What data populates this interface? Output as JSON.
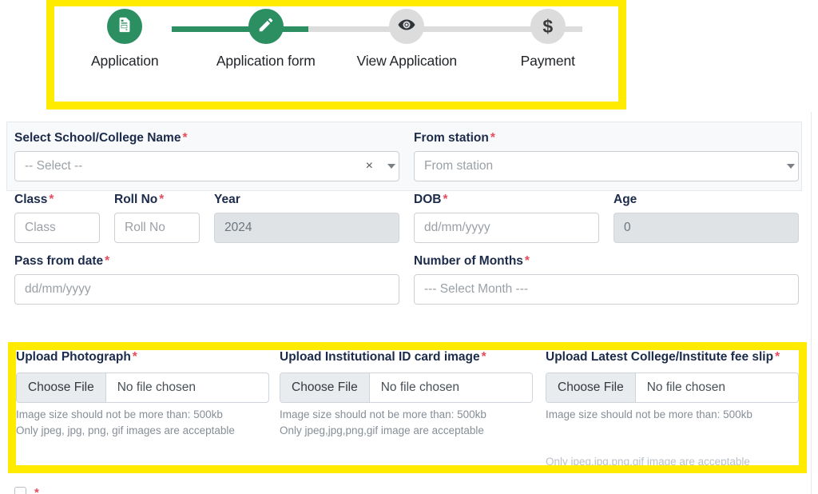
{
  "stepper": {
    "steps": [
      {
        "label": "Application",
        "icon": "document-icon",
        "state": "done"
      },
      {
        "label": "Application form",
        "icon": "pencil-icon",
        "state": "done"
      },
      {
        "label": "View Application",
        "icon": "eye-icon",
        "state": "pending"
      },
      {
        "label": "Payment",
        "icon": "dollar-icon",
        "state": "pending"
      }
    ],
    "active_color": "#2b8f62",
    "inactive_color": "#dcdcdc",
    "highlight_color": "#ffeb00"
  },
  "form": {
    "school": {
      "label": "Select School/College Name",
      "required": "*",
      "value": "-- Select --",
      "clear": "×"
    },
    "from_station": {
      "label": "From station",
      "required": "*",
      "placeholder": "From station"
    },
    "class": {
      "label": "Class",
      "required": "*",
      "placeholder": "Class"
    },
    "roll_no": {
      "label": "Roll No",
      "required": "*",
      "placeholder": "Roll No"
    },
    "year": {
      "label": "Year",
      "value": "2024",
      "disabled": true
    },
    "dob": {
      "label": "DOB",
      "required": "*",
      "placeholder": "dd/mm/yyyy"
    },
    "age": {
      "label": "Age",
      "value": "0",
      "disabled": true
    },
    "pass_from_date": {
      "label": "Pass from date",
      "required": "*",
      "placeholder": "dd/mm/yyyy"
    },
    "number_of_months": {
      "label": "Number of Months",
      "required": "*",
      "value": "--- Select Month ---"
    }
  },
  "uploads": {
    "choose_file_label": "Choose File",
    "no_file_label": "No file chosen",
    "items": [
      {
        "label": "Upload Photograph",
        "required": "*",
        "hint1": "Image size should not be more than: 500kb",
        "hint2": "Only jpeg, jpg, png, gif images are acceptable"
      },
      {
        "label": "Upload Institutional ID card image",
        "required": "*",
        "hint1": "Image size should not be more than: 500kb",
        "hint2": "Only jpeg,jpg,png,gif image are acceptable"
      },
      {
        "label": "Upload Latest College/Institute fee slip",
        "required": "*",
        "hint1": "Image size should not be more than: 500kb",
        "hint2": "Only jpeg,jpg,png,gif image are acceptable"
      }
    ]
  },
  "footer": {
    "checkbox_required": "*"
  }
}
